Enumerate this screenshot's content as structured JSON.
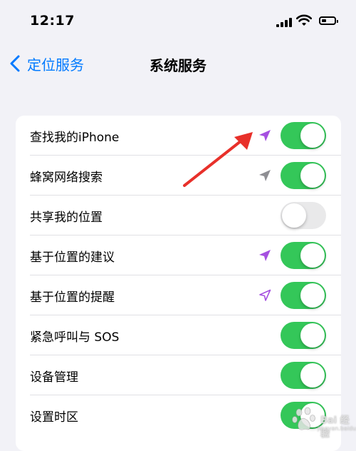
{
  "status_bar": {
    "time": "12:17"
  },
  "nav": {
    "back_label": "定位服务",
    "title": "系统服务"
  },
  "rows": [
    {
      "label": "查找我的iPhone",
      "toggle": "on",
      "location_icon": "purple-filled-arrow"
    },
    {
      "label": "蜂窝网络搜索",
      "toggle": "on",
      "location_icon": "gray-filled-arrow"
    },
    {
      "label": "共享我的位置",
      "toggle": "off",
      "location_icon": ""
    },
    {
      "label": "基于位置的建议",
      "toggle": "on",
      "location_icon": "purple-filled-arrow"
    },
    {
      "label": "基于位置的提醒",
      "toggle": "on",
      "location_icon": "purple-outline-arrow"
    },
    {
      "label": "紧急呼叫与 SOS",
      "toggle": "on",
      "location_icon": ""
    },
    {
      "label": "设备管理",
      "toggle": "on",
      "location_icon": ""
    },
    {
      "label": "设置时区",
      "toggle": "on",
      "location_icon": ""
    }
  ],
  "colors": {
    "accent": "#007aff",
    "toggle_on": "#34c759",
    "toggle_off": "#e9e9ea",
    "location_purple": "#a550e0",
    "location_gray": "#8e8e93",
    "annotation_red": "#e8302a",
    "background": "#f2f2f7"
  },
  "watermark": {
    "text": "Bai 经验",
    "sub": "jingyan.baidu.com"
  }
}
